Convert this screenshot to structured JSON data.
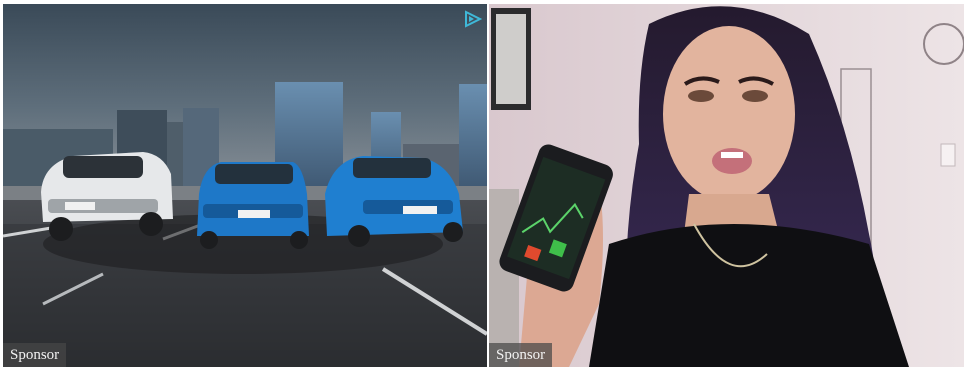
{
  "ads": [
    {
      "sponsor_label": "Sponsor",
      "adchoices_icon": "play-triangle-icon"
    },
    {
      "sponsor_label": "Sponsor"
    }
  ],
  "colors": {
    "sponsor_bg": "#464646",
    "car_blue": "#1e78c8",
    "car_white": "#e6e8ea",
    "adchoices": "#3fb8d8"
  }
}
